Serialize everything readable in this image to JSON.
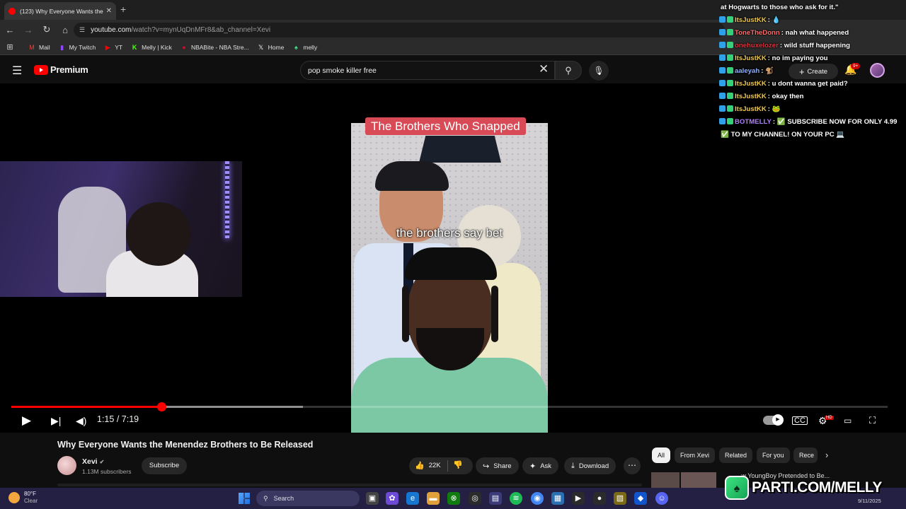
{
  "browser": {
    "tab_title": "(123) Why Everyone Wants the",
    "url_host": "youtube.com",
    "url_path": "/watch?v=mynUqDnMFr8&ab_channel=Xevi",
    "bookmarks": [
      {
        "label": "Mail",
        "icon": "gmail-icon",
        "color": "#ea4335"
      },
      {
        "label": "My Twitch",
        "icon": "twitch-icon",
        "color": "#9146ff"
      },
      {
        "label": "YT",
        "icon": "youtube-icon",
        "color": "#ff0000"
      },
      {
        "label": "Melly | Kick",
        "icon": "kick-icon",
        "color": "#53fc18"
      },
      {
        "label": "NBABite - NBA Stre...",
        "icon": "nba-icon",
        "color": "#c8102e"
      },
      {
        "label": "Home",
        "icon": "x-icon",
        "color": "#ffffff"
      },
      {
        "label": "melly",
        "icon": "parti-icon",
        "color": "#3fe27f"
      }
    ]
  },
  "youtube": {
    "brand": "Premium",
    "search_value": "pop smoke killer free",
    "create_label": "Create",
    "notification_count": "9+"
  },
  "video": {
    "overlay_title": "The Brothers Who Snapped",
    "caption": "the brothers say bet",
    "time_current": "1:15",
    "time_total": "7:19",
    "played_fraction": 0.171,
    "buffered_fraction": 0.333,
    "title": "Why Everyone Wants the Menendez Brothers to Be Released",
    "channel_name": "Xevi",
    "subscribers": "1.13M subscribers",
    "subscribe_label": "Subscribe",
    "likes": "22K",
    "share_label": "Share",
    "ask_label": "Ask",
    "download_label": "Download"
  },
  "chips": [
    "All",
    "From Xevi",
    "Related",
    "For you",
    "Rece"
  ],
  "up_next_title": "...w YoungBoy Pretended to Be...",
  "chat": [
    {
      "user": "",
      "message": "at Hogwarts to those who ask for it.\"",
      "color": "#ffffff"
    },
    {
      "user": "ItsJustKK",
      "message": "💧",
      "color": "#f2c744"
    },
    {
      "user": "ToneTheDonn",
      "message": "nah what happened",
      "color": "#ff6b6b"
    },
    {
      "user": "onehuxelozer",
      "message": "wild stuff happening",
      "color": "#e0323c"
    },
    {
      "user": "ItsJustKK",
      "message": "no im paying you",
      "color": "#f2c744"
    },
    {
      "user": "aaleyah",
      "message": "🐒",
      "color": "#8fb0ff"
    },
    {
      "user": "ItsJustKK",
      "message": "u dont wanna get paid?",
      "color": "#f2c744"
    },
    {
      "user": "ItsJustKK",
      "message": "okay then",
      "color": "#f2c744"
    },
    {
      "user": "ItsJustKK",
      "message": "🐸",
      "color": "#f2c744"
    },
    {
      "user": "BOTMELLY",
      "message": "✅ SUBSCRIBE NOW FOR ONLY 4.99",
      "color": "#b07dff"
    },
    {
      "user": "",
      "message": "✅ TO MY CHANNEL! ON YOUR PC 💻",
      "color": "#ffffff"
    }
  ],
  "taskbar": {
    "temperature": "80°F",
    "condition": "Clear",
    "search_label": "Search",
    "date": "9/11/2025"
  },
  "watermark": "PARTI.COM/MELLY"
}
